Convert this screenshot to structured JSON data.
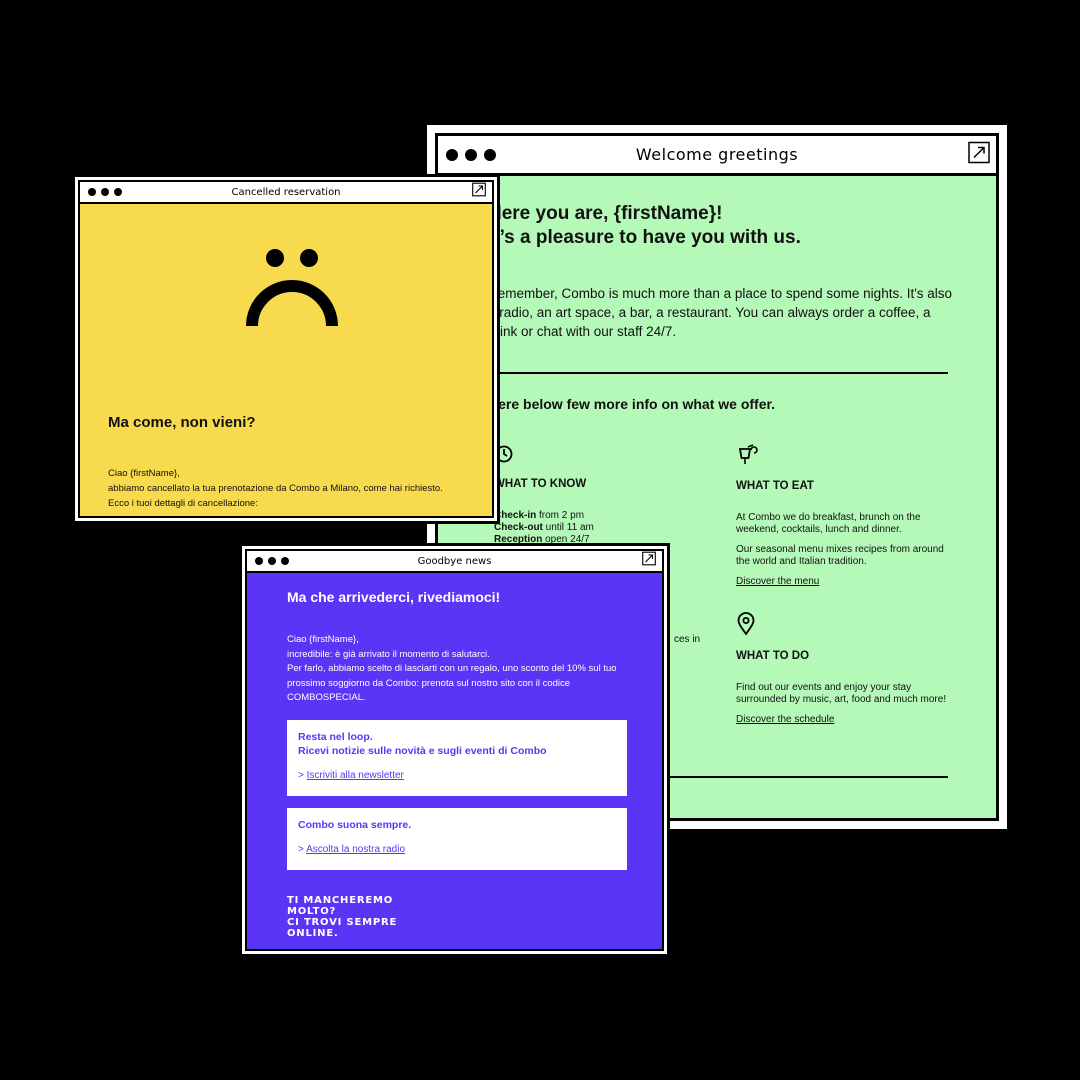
{
  "welcome": {
    "title": "Welcome greetings",
    "headline_1": "Here you are, {firstName}!",
    "headline_2": "It’s a pleasure to have you with us.",
    "intro": "Remember, Combo is much more than a place to spend some nights. It's also a radio, an art space, a bar, a restaurant. You can always order a coffee, a drink or chat with our staff 24/7.",
    "info_heading": "Here below few more info on what we offer.",
    "know": {
      "title": "WHAT TO KNOW",
      "checkin_label": "Check-in",
      "checkin_value": " from 2 pm",
      "checkout_label": "Check-out",
      "checkout_value": " until 11 am",
      "reception_label": "Reception",
      "reception_value": " open 24/7"
    },
    "stray_text": "ces in",
    "eat": {
      "title": "WHAT TO EAT",
      "p1": "At Combo we do breakfast, brunch on the weekend, cocktails, lunch and dinner.",
      "p2": "Our seasonal menu mixes recipes from around the world and Italian tradition.",
      "link": "Discover the menu"
    },
    "do": {
      "title": "WHAT TO DO",
      "p1": "Find out our events and enjoy your stay surrounded by music, art, food and much more!",
      "link": "Discover the schedule"
    },
    "icons": [
      "clock-icon",
      "cocktail-icon",
      "location-pin-icon",
      "expand-icon"
    ],
    "bg_color": "#b5f9b8"
  },
  "cancelled": {
    "title": "Cancelled reservation",
    "heading": "Ma come, non vieni?",
    "line1": "Ciao {firstName},",
    "line2": "abbiamo cancellato la tua prenotazione da Combo a Milano, come hai richiesto. Ecco i tuoi dettagli di cancellazione:",
    "icons": [
      "sad-face-icon",
      "expand-icon"
    ],
    "bg_color": "#f8da4e"
  },
  "goodbye": {
    "title": "Goodbye news",
    "heading": "Ma che arrivederci, rivediamoci!",
    "line1": "Ciao {firstName},",
    "line2": "incredibile: è già arrivato il momento di salutarci.",
    "line3": "Per farlo, abbiamo scelto di lasciarti con un regalo, uno sconto del 10% sul tuo prossimo soggiorno da Combo: prenota sul nostro sito con il codice COMBOSPECIAL.",
    "card1_title_1": "Resta nel loop.",
    "card1_title_2": "Ricevi notizie sulle novità e sugli eventi di Combo",
    "card1_prefix": "> ",
    "card1_link": "Iscriviti alla newsletter",
    "card2_title": "Combo suona sempre.",
    "card2_prefix": "> ",
    "card2_link": "Ascolta la nostra radio",
    "footer": "TI MANCHEREMO\nMOLTO?\nCI TROVI SEMPRE\nONLINE.",
    "icons": [
      "expand-icon"
    ],
    "bg_color": "#5b35f6"
  }
}
